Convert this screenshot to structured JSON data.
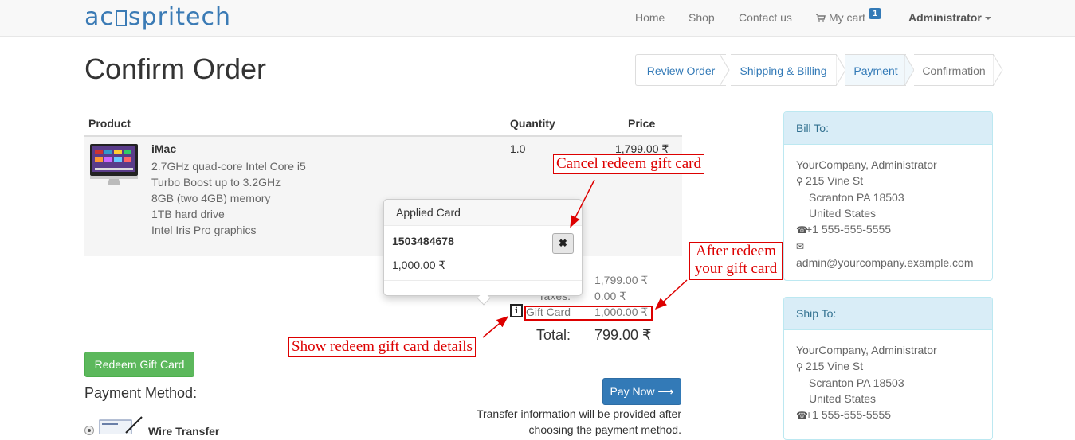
{
  "navbar": {
    "logo_left": "ac",
    "logo_right": "spritech",
    "home": "Home",
    "shop": "Shop",
    "contact": "Contact us",
    "cart": "My cart",
    "cart_count": "1",
    "user": "Administrator"
  },
  "page_title": "Confirm Order",
  "wizard": {
    "steps": [
      {
        "label": "Review Order",
        "state": "done"
      },
      {
        "label": "Shipping & Billing",
        "state": "done"
      },
      {
        "label": "Payment",
        "state": "active"
      },
      {
        "label": "Confirmation",
        "state": "disabled"
      }
    ]
  },
  "cart": {
    "headers": {
      "product": "Product",
      "quantity": "Quantity",
      "price": "Price"
    },
    "items": [
      {
        "name": "iMac",
        "description": [
          "2.7GHz quad-core Intel Core i5",
          "Turbo Boost up to 3.2GHz",
          "8GB (two 4GB) memory",
          "1TB hard drive",
          "Intel Iris Pro graphics"
        ],
        "quantity": "1.0",
        "price": "1,799.00 ₹"
      }
    ]
  },
  "totals": {
    "subtotal_value": "1,799.00 ₹",
    "taxes_label": "Taxes:",
    "taxes_value": "0.00 ₹",
    "gift_label": "Gift Card",
    "gift_value": "1,000.00 ₹",
    "total_label": "Total:",
    "total_value": "799.00 ₹"
  },
  "popover": {
    "title": "Applied Card",
    "code": "1503484678",
    "amount": "1,000.00 ₹",
    "close_glyph": "✖"
  },
  "buttons": {
    "redeem": "Redeem Gift Card",
    "pay_now": "Pay Now"
  },
  "payment": {
    "label": "Payment Method:",
    "note": "Transfer information will be provided after choosing the payment method.",
    "options": [
      {
        "label": "Wire Transfer",
        "selected": true
      }
    ]
  },
  "bill_to": {
    "title": "Bill To:",
    "name": "YourCompany, Administrator",
    "street": "215 Vine St",
    "city": "Scranton PA 18503",
    "country": "United States",
    "phone": "+1 555-555-5555",
    "email": "admin@yourcompany.example.com"
  },
  "ship_to": {
    "title": "Ship To:",
    "name": "YourCompany, Administrator",
    "street": "215 Vine St",
    "city": "Scranton PA 18503",
    "country": "United States",
    "phone": "+1 555-555-5555"
  },
  "annotations": {
    "cancel": "Cancel redeem gift card",
    "after_line1": "After redeem",
    "after_line2": "your gift card",
    "show": "Show redeem gift card details"
  },
  "colors": {
    "annotation": "#dd0000",
    "primary": "#337ab7",
    "success": "#5cb85c",
    "panel_info": "#d9edf7"
  }
}
